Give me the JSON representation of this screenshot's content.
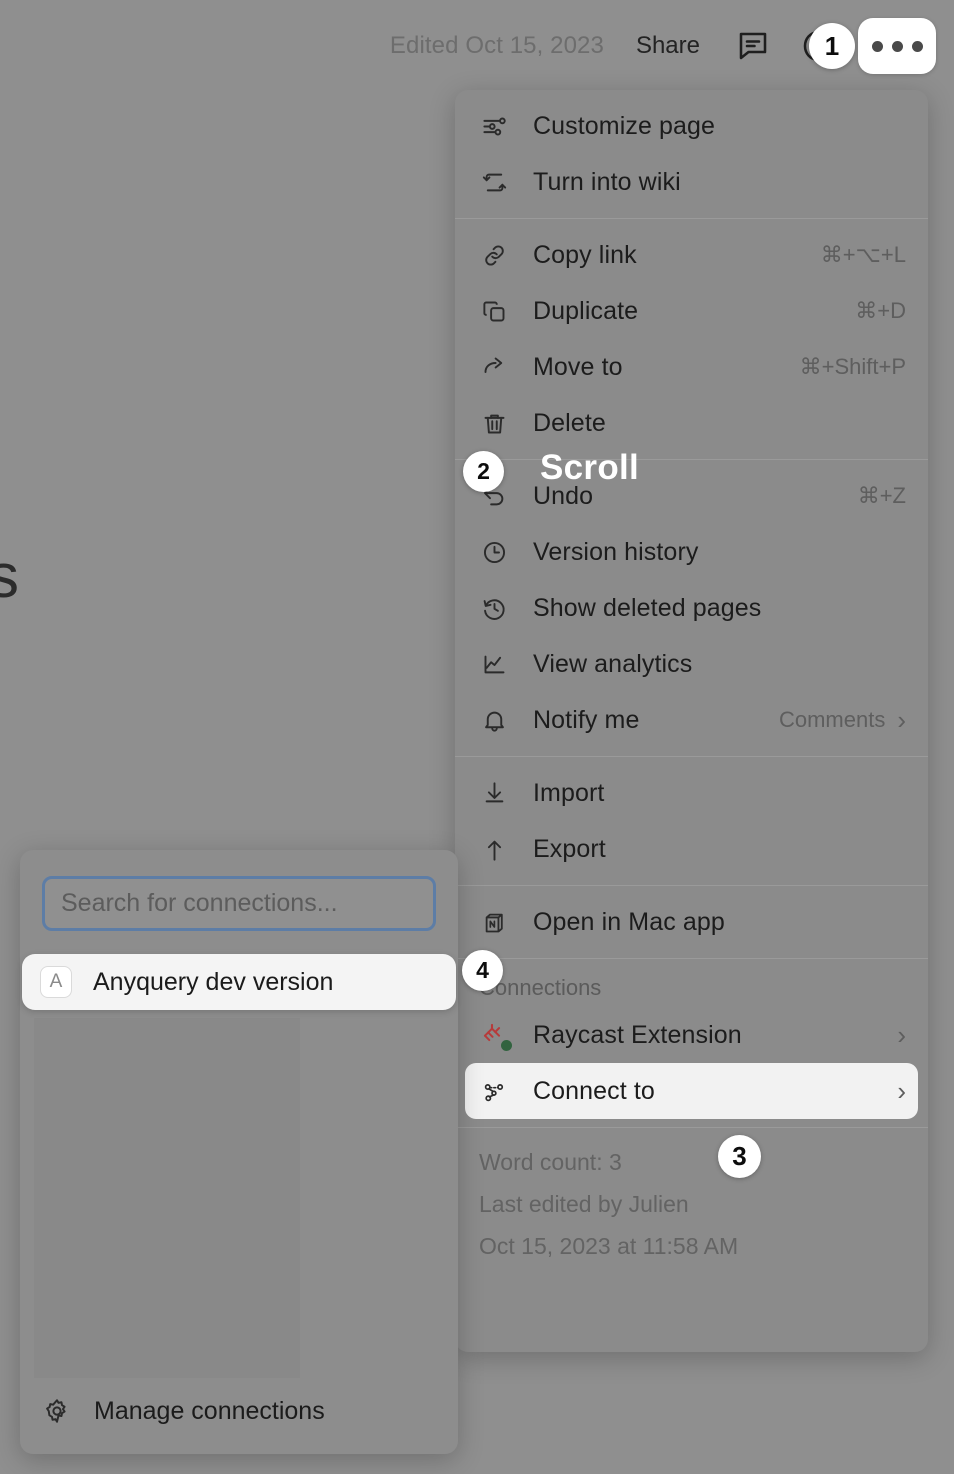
{
  "topbar": {
    "edited_text": "Edited Oct 15, 2023",
    "share_label": "Share",
    "comment_icon": "comment-icon",
    "history_icon": "clock-icon",
    "more_icon": "ellipsis-icon"
  },
  "page_glyph": "s",
  "menu": {
    "group1": [
      {
        "icon": "sliders-icon",
        "label": "Customize page",
        "accel": ""
      },
      {
        "icon": "turn-into-wiki-icon",
        "label": "Turn into wiki",
        "accel": ""
      }
    ],
    "group2": [
      {
        "icon": "link-icon",
        "label": "Copy link",
        "accel": "⌘+⌥+L"
      },
      {
        "icon": "duplicate-icon",
        "label": "Duplicate",
        "accel": "⌘+D"
      },
      {
        "icon": "move-to-icon",
        "label": "Move to",
        "accel": "⌘+Shift+P"
      },
      {
        "icon": "trash-icon",
        "label": "Delete",
        "accel": ""
      }
    ],
    "group3": [
      {
        "icon": "undo-icon",
        "label": "Undo",
        "accel": "⌘+Z"
      },
      {
        "icon": "clock-icon",
        "label": "Version history",
        "accel": ""
      },
      {
        "icon": "restore-icon",
        "label": "Show deleted pages",
        "accel": ""
      },
      {
        "icon": "analytics-icon",
        "label": "View analytics",
        "accel": ""
      },
      {
        "icon": "bell-icon",
        "label": "Notify me",
        "accel": "Comments",
        "chevron": "›"
      }
    ],
    "group4": [
      {
        "icon": "import-icon",
        "label": "Import",
        "accel": ""
      },
      {
        "icon": "export-icon",
        "label": "Export",
        "accel": ""
      }
    ],
    "group5": [
      {
        "icon": "notion-app-icon",
        "label": "Open in Mac app",
        "accel": ""
      }
    ],
    "connections_section_label": "Connections",
    "connections": [
      {
        "icon": "raycast-icon",
        "label": "Raycast Extension",
        "chevron": "›",
        "highlighted": false
      },
      {
        "icon": "connect-to-icon",
        "label": "Connect to",
        "chevron": "›",
        "highlighted": true
      }
    ],
    "footer": {
      "word_count": "Word count: 3",
      "last_edited_by": "Last edited by Julien",
      "last_edited_at": "Oct 15, 2023 at 11:58 AM"
    }
  },
  "connections_popup": {
    "search_placeholder": "Search for connections...",
    "search_value": "",
    "result": {
      "badge": "A",
      "label": "Anyquery dev version"
    },
    "footer": {
      "icon": "gear-icon",
      "label": "Manage connections"
    }
  },
  "annotations": {
    "badge1": "1",
    "badge2": "2",
    "badge3": "3",
    "badge4": "4",
    "scroll_label": "Scroll"
  },
  "colors": {
    "backdrop": "#8f8f8f",
    "menu_bg": "#8b8b8b",
    "highlight_bg": "#f2f2f2",
    "focus_border": "#5d7da6",
    "raycast_red": "#b63b3b",
    "status_green": "#32633f",
    "badge_white": "#ffffff"
  }
}
